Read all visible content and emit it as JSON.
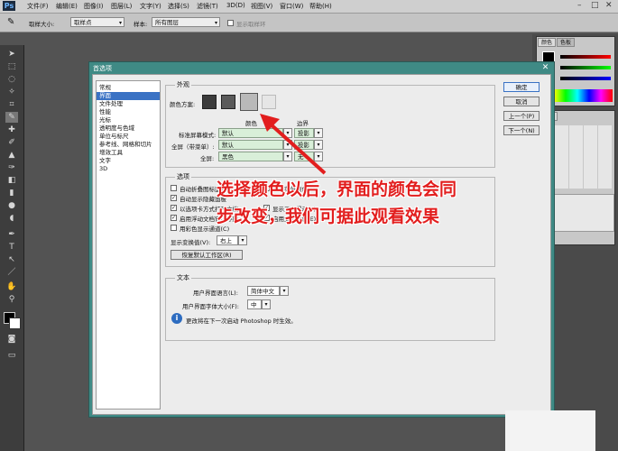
{
  "app": {
    "logo": "Ps"
  },
  "menubar": {
    "items": [
      "文件(F)",
      "编辑(E)",
      "图像(I)",
      "图层(L)",
      "文字(Y)",
      "选择(S)",
      "滤镜(T)",
      "3D(D)",
      "视图(V)",
      "窗口(W)",
      "帮助(H)"
    ]
  },
  "options_bar": {
    "sample_size_label": "取样大小:",
    "sample_size_value": "取样点",
    "sample_label": "样本:",
    "sample_value": "所有图层",
    "ring_label": "显示取样环"
  },
  "dialog": {
    "title": "首选项",
    "categories": [
      "常规",
      "界面",
      "文件处理",
      "性能",
      "光标",
      "透明度与色域",
      "单位与标尺",
      "参考线、网格和切片",
      "增效工具",
      "文字",
      "3D"
    ],
    "selected_index": 1,
    "appearance": {
      "title": "外观",
      "color_scheme_label": "颜色方案:",
      "swatches": [
        "#3b3b3b",
        "#5a5a5a",
        "#b9b9b9",
        "#e6e6e6"
      ],
      "color_col": "颜色",
      "border_col": "边界",
      "rows": [
        {
          "label": "标准屏幕模式:",
          "color": "默认",
          "border": "投影"
        },
        {
          "label": "全屏（带菜单）:",
          "color": "默认",
          "border": "投影"
        },
        {
          "label": "全屏:",
          "color": "黑色",
          "border": "无"
        }
      ]
    },
    "options": {
      "title": "选项",
      "checks": [
        {
          "label": "自动折叠图标面板",
          "checked": false
        },
        {
          "label": "自动显示隐藏面板",
          "checked": true
        },
        {
          "label": "以选项卡方式打开文档",
          "checked": true
        },
        {
          "label": "启用浮动文档窗口停放",
          "checked": true
        },
        {
          "label": "用彩色显示通道(C)",
          "checked": false
        }
      ],
      "right_checks": [
        "显示菜单颜色(M)",
        "显示工具提示(T)",
        "启用文本投影(E)"
      ],
      "transform_label": "显示变换值(V):",
      "transform_value": "右上",
      "restore_button": "恢复默认工作区(R)"
    },
    "text": {
      "title": "文本",
      "ui_lang_label": "用户界面语言(L):",
      "ui_lang_value": "简体中文",
      "ui_font_label": "用户界面字体大小(F):",
      "ui_font_value": "中",
      "note": "更改将在下一次启动 Photoshop 时生效。"
    },
    "buttons": {
      "ok": "确定",
      "cancel": "取消",
      "prev": "上一个(P)",
      "next": "下一个(N)"
    }
  },
  "annotation": {
    "line1": "选择颜色以后，界面的颜色会同",
    "line2": "步改变，我们可据此观看效果",
    "color": "#e21e1e"
  },
  "right_panels": {
    "tab1": "颜色",
    "tab2": "色板",
    "tab3": "样式"
  }
}
